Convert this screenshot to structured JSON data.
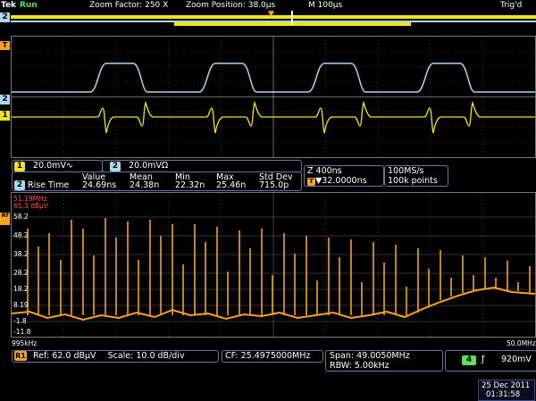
{
  "status_bar": {
    "brand": "Tek",
    "run_state": "Run",
    "zoom_factor": "Zoom Factor: 250 X",
    "zoom_position": "Zoom Position: 38.0µs",
    "horizontal": "M 100µs",
    "trigger_state": "Trig'd"
  },
  "channel_markers": {
    "overview": "2",
    "ch2": "2",
    "ch1": "1",
    "trigger": "T"
  },
  "channel_readouts": {
    "ch1_label": "1",
    "ch1_scale": "20.0mV∿",
    "ch2_label": "2",
    "ch2_scale": "20.0mVΩ"
  },
  "measurement": {
    "source": "2",
    "name": "Rise Time",
    "headers": [
      "Value",
      "Mean",
      "Min",
      "Max",
      "Std Dev"
    ],
    "values": [
      "24.69ns",
      "24.38n",
      "22.32n",
      "25.46n",
      "715.0p"
    ]
  },
  "timebase": {
    "zoom": "Z 400ns",
    "trigger_pos": "▼32.0000ns",
    "trigger_marker": "T",
    "sample_rate": "100MS/s",
    "record_length": "100k points"
  },
  "spectrum": {
    "marker_freq": "51.19MHz",
    "marker_level": "65.3 dBµV",
    "marker_tag": "Rf",
    "y_ticks": [
      "58.2",
      "48.2",
      "38.2",
      "28.2",
      "18.2",
      "8.19",
      "-1.8",
      "-11.8"
    ],
    "start_freq": "995kHz",
    "stop_freq": "50.0MHz"
  },
  "rf_settings": {
    "badge": "R1",
    "reference": "Ref: 62.0 dBµV",
    "scale": "Scale: 10.0 dB/div",
    "center": "CF: 25.4975000MHz",
    "span": "Span:   49.0050MHz",
    "rbw": "RBW:    5.00kHz",
    "trig_channel": "4",
    "trig_slope": "ƒ",
    "trig_level": "920mV"
  },
  "datetime": {
    "date": "25 Dec 2011",
    "time": "01:31:58"
  },
  "colors": {
    "ch1": "#f2e31a",
    "ch2": "#a9d8f0",
    "rf": "#f7a31d",
    "grid": "#5a5a5a",
    "panel_border": "#6673a3"
  }
}
